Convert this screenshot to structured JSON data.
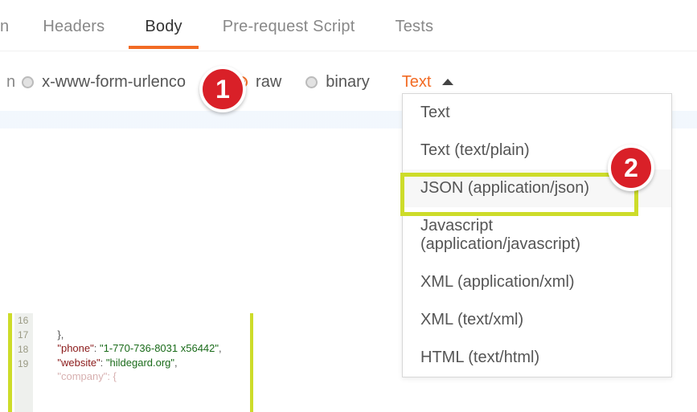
{
  "tabs": {
    "partial": "n",
    "headers": "Headers",
    "body": "Body",
    "prerequest": "Pre-request Script",
    "tests": "Tests",
    "active": "body"
  },
  "body_options": {
    "opt1": "x-www-form-urlenco",
    "opt2": "raw",
    "opt3": "binary",
    "selected": "raw"
  },
  "content_type": {
    "trigger": "Text",
    "items": [
      "Text",
      "Text (text/plain)",
      "JSON (application/json)",
      "Javascript (application/javascript)",
      "XML (application/xml)",
      "XML (text/xml)",
      "HTML (text/html)"
    ],
    "highlighted_index": 2
  },
  "annotations": {
    "badge1": "1",
    "badge2": "2"
  },
  "code": {
    "gutter": [
      "16",
      "17",
      "18",
      "19"
    ],
    "line16_punc": "},",
    "line17_key": "\"phone\"",
    "line17_sep": ": ",
    "line17_val": "\"1-770-736-8031 x56442\"",
    "line17_end": ",",
    "line18_key": "\"website\"",
    "line18_sep": ": ",
    "line18_val": "\"hildegard.org\"",
    "line18_end": ",",
    "line19": "\"company\": {"
  }
}
